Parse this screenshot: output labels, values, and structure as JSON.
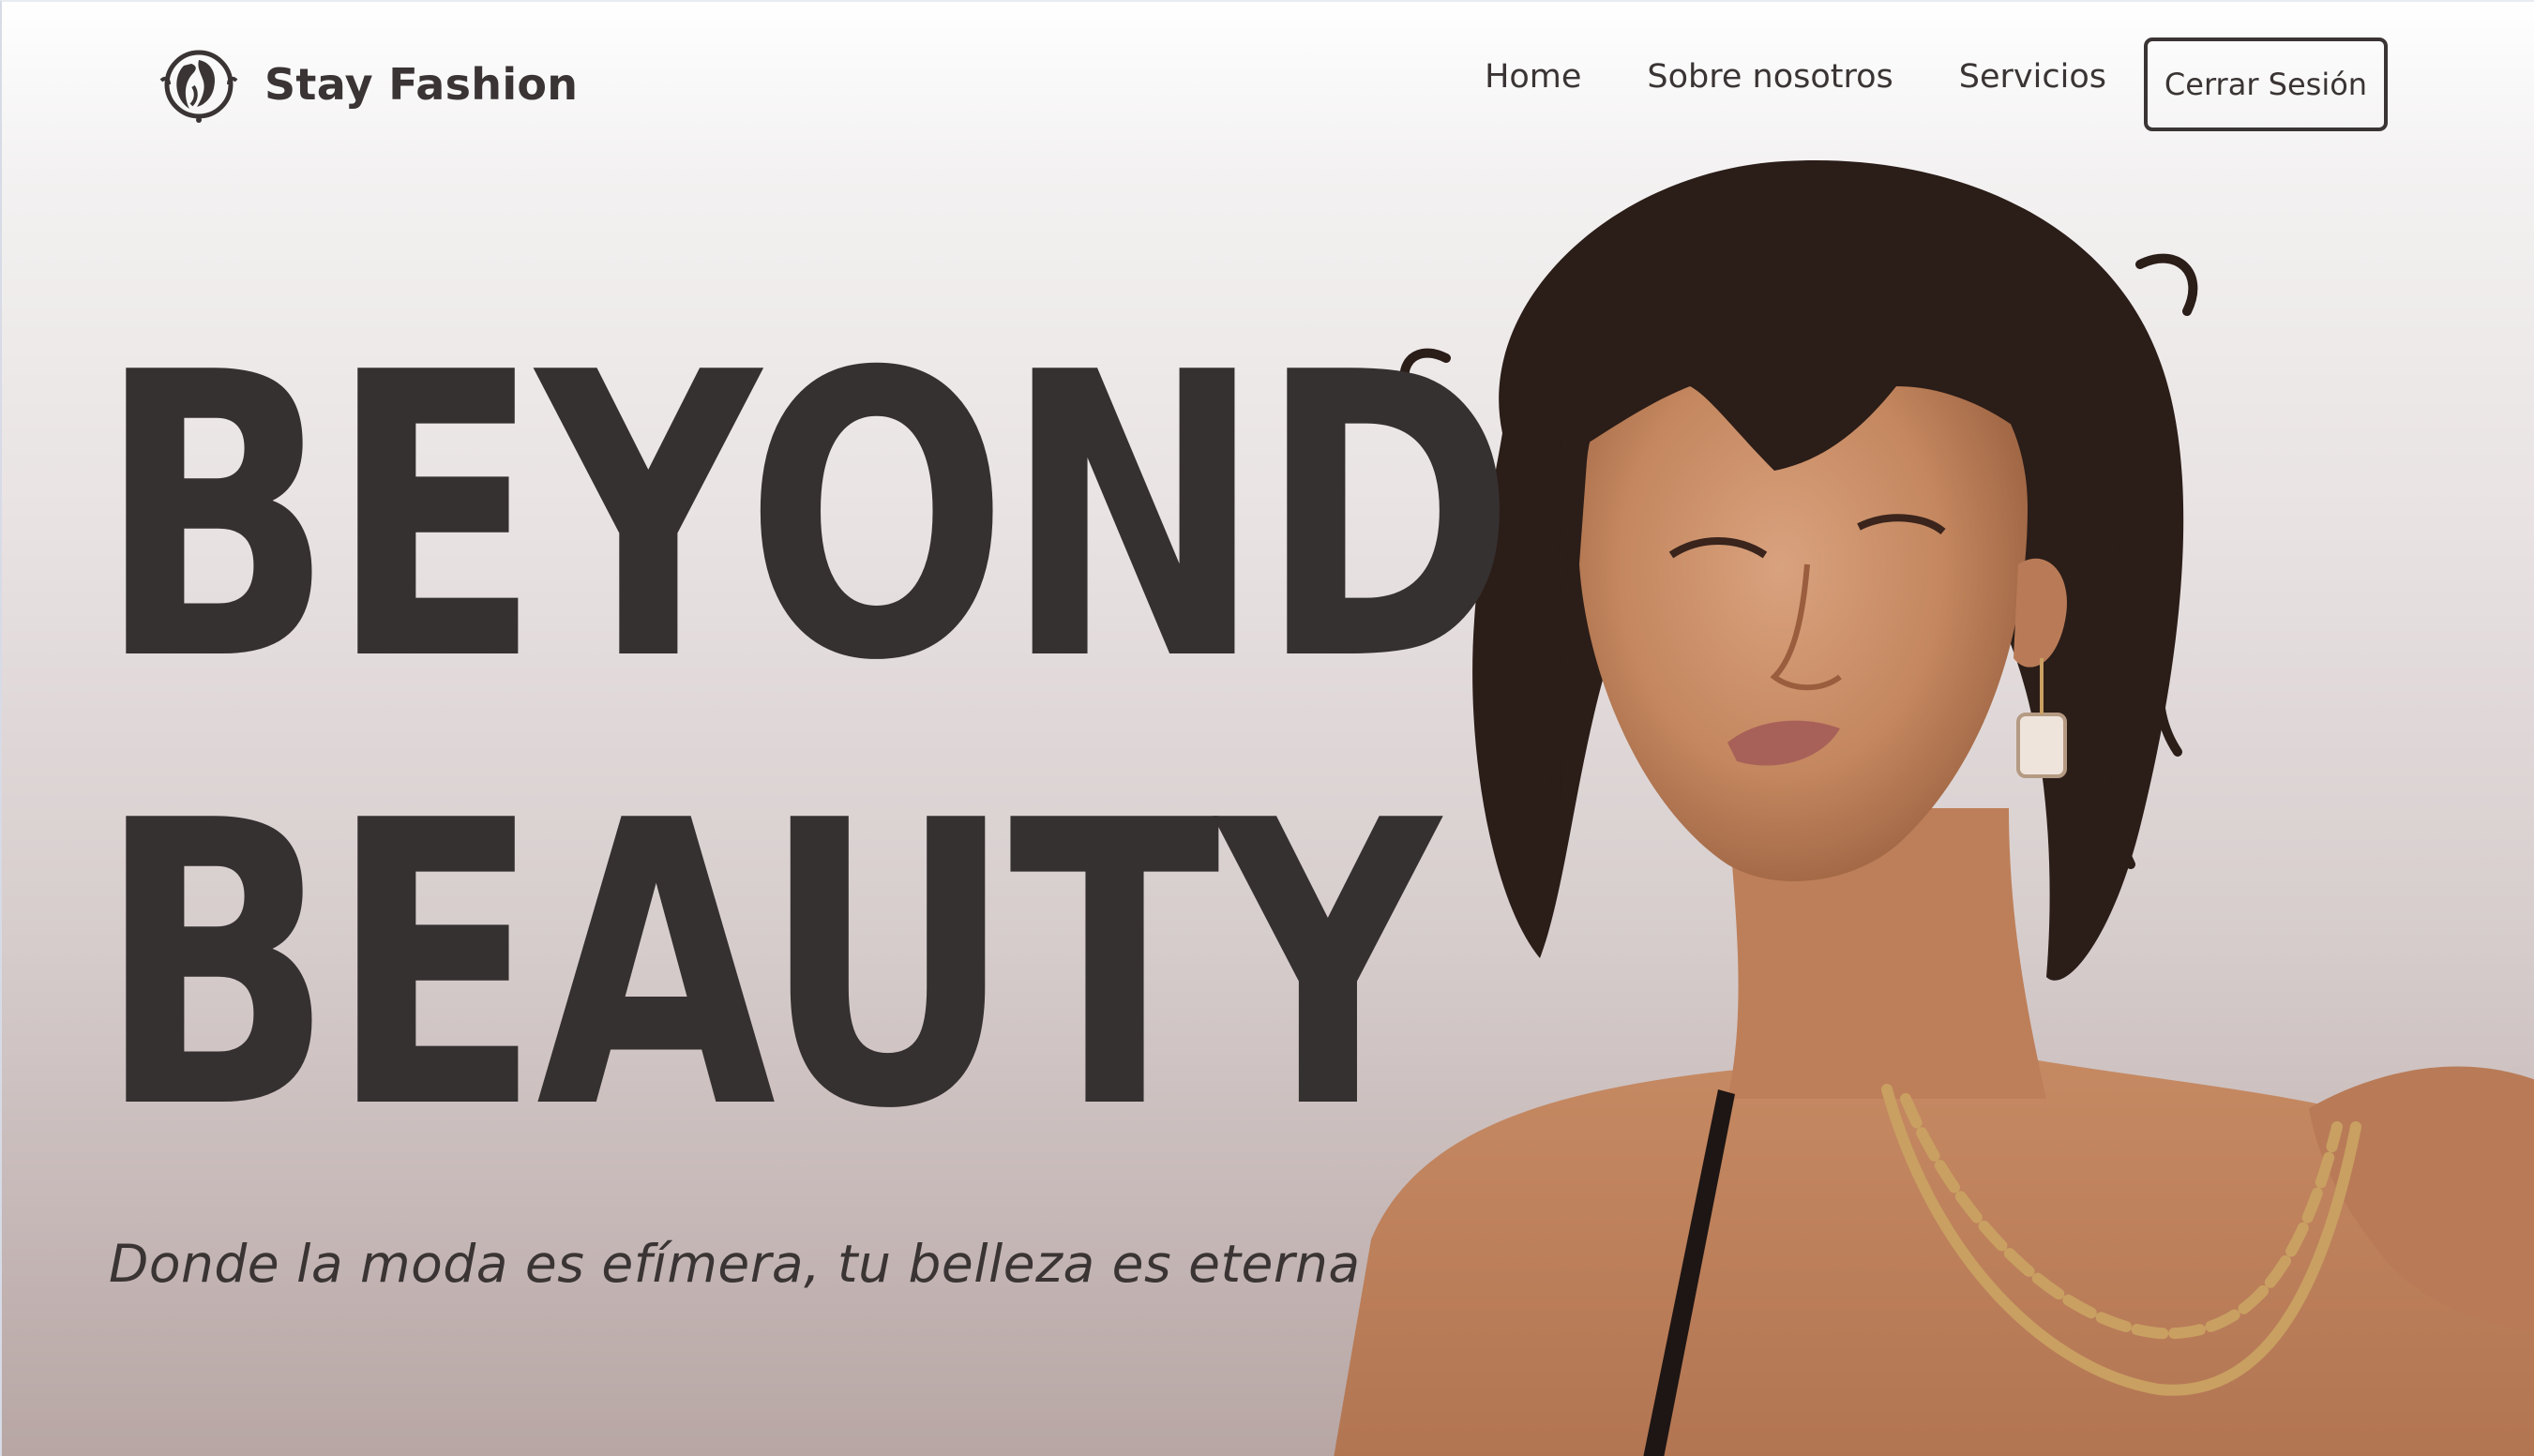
{
  "brand": {
    "name": "Stay Fashion",
    "logo_icon": "woman-silhouette-logo-icon"
  },
  "nav": {
    "links": [
      {
        "label": "Home"
      },
      {
        "label": "Sobre nosotros"
      },
      {
        "label": "Servicios"
      }
    ],
    "logout_label": "Cerrar Sesión"
  },
  "hero": {
    "line1": "BEYOND",
    "line2": "BEAUTY",
    "tagline": "Donde la moda es efímera, tu belleza es eterna"
  },
  "colors": {
    "text": "#363131",
    "background_top": "#ffffff",
    "background_bottom": "#b7a6a4",
    "skin": "#c98e6a",
    "hair": "#2b1d18",
    "gold": "#c9a062"
  }
}
